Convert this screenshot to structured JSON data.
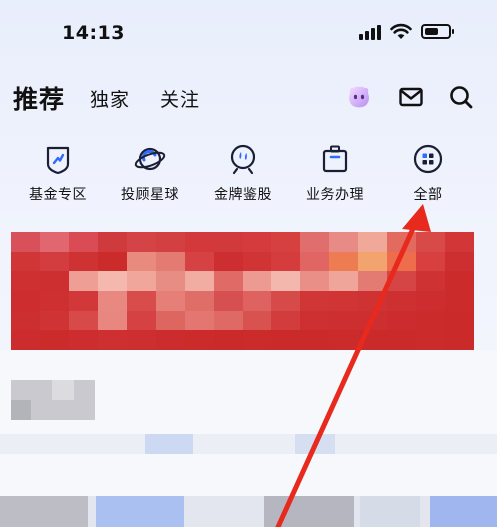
{
  "status_bar": {
    "time": "14:13",
    "icons": [
      "cellular-signal-icon",
      "wifi-icon",
      "battery-icon"
    ]
  },
  "top_nav": {
    "tabs": [
      {
        "label": "推荐",
        "active": true
      },
      {
        "label": "独家",
        "active": false
      },
      {
        "label": "关注",
        "active": false
      }
    ],
    "icons": [
      "mascot-avatar-icon",
      "mail-icon",
      "search-icon"
    ]
  },
  "quick_menu": {
    "items": [
      {
        "label": "基金专区",
        "icon": "fund-shield-icon"
      },
      {
        "label": "投顾星球",
        "icon": "planet-icon"
      },
      {
        "label": "金牌鉴股",
        "icon": "magnifier-stock-icon"
      },
      {
        "label": "业务办理",
        "icon": "briefcase-icon"
      },
      {
        "label": "全部",
        "icon": "grid-all-icon"
      }
    ]
  },
  "colors": {
    "accent_red": "#d33233",
    "annotation_arrow": "#e8291d",
    "text": "#111111",
    "background": "#eef2fc"
  }
}
